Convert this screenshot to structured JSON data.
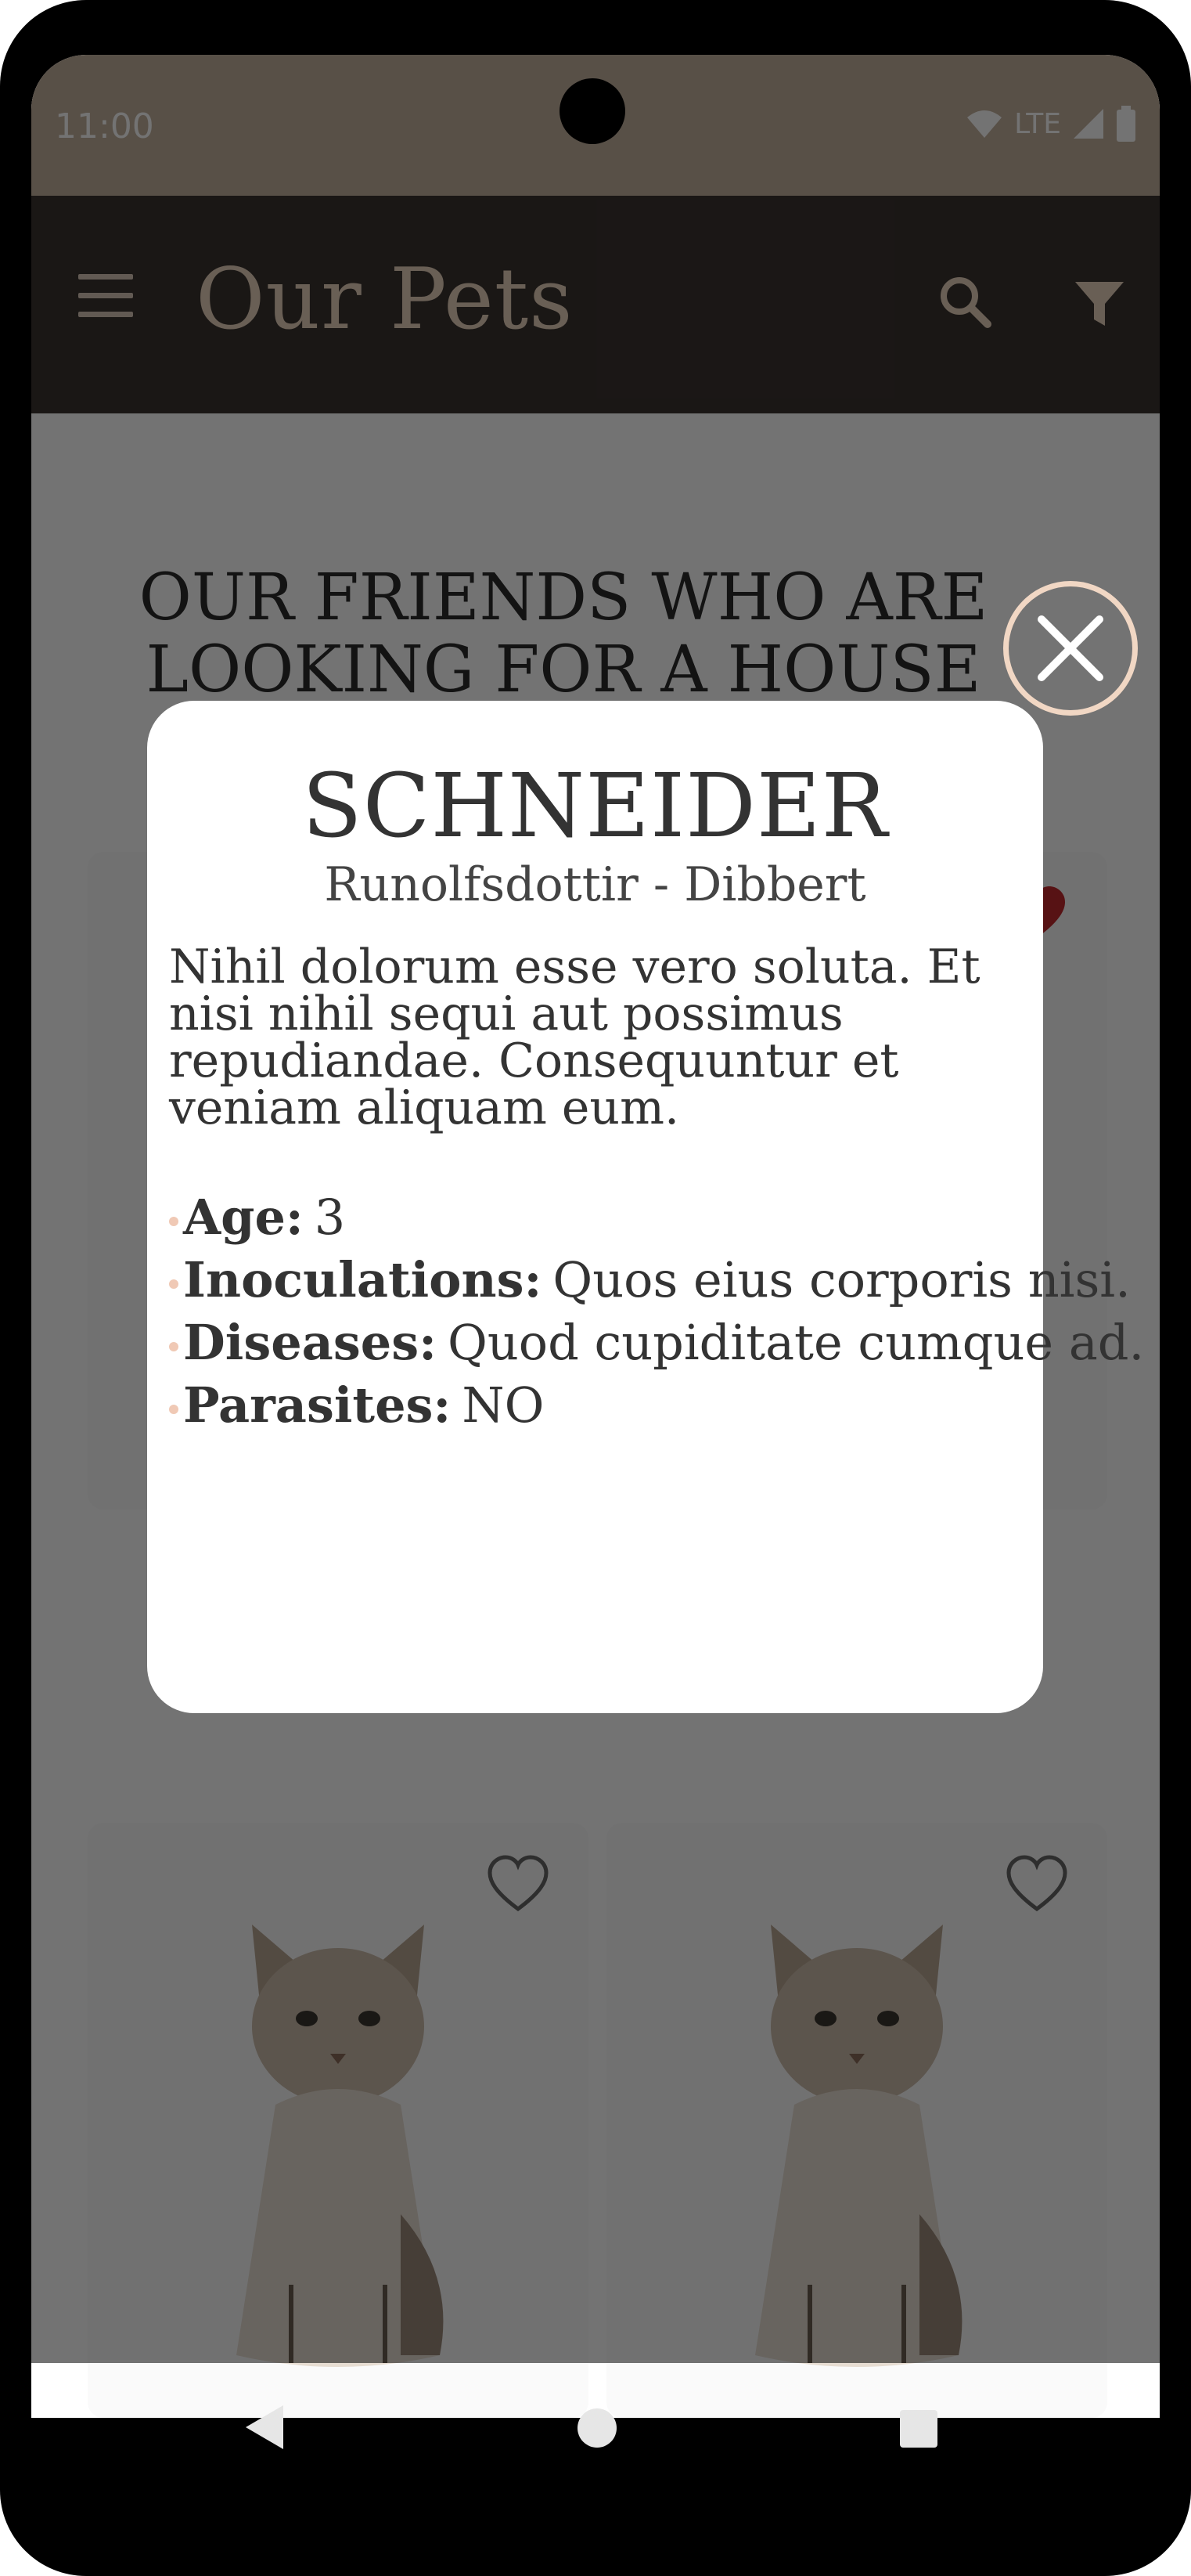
{
  "status_bar": {
    "time": "11:00",
    "network": "LTE"
  },
  "app_bar": {
    "title": "Our Pets"
  },
  "main": {
    "section_title": "OUR FRIENDS WHO ARE LOOKING FOR A HOUSE"
  },
  "modal": {
    "name": "SCHNEIDER",
    "organization": "Runolfsdottir - Dibbert",
    "description": "Nihil dolorum esse vero soluta. Et nisi nihil sequi aut possimus repudiandae. Consequuntur et veniam aliquam eum.",
    "facts": [
      {
        "label": "Age:",
        "value": "3"
      },
      {
        "label": "Inoculations:",
        "value": "Quos eius corporis nisi."
      },
      {
        "label": "Diseases:",
        "value": "Quod cupiditate cumque ad."
      },
      {
        "label": "Parasites:",
        "value": "NO"
      }
    ]
  },
  "icons": {
    "menu": "menu-icon",
    "search": "search-icon",
    "filter": "filter-icon",
    "favorite": "heart-icon",
    "close": "close-icon",
    "back": "back-icon",
    "home": "home-icon",
    "recents": "recents-icon"
  },
  "colors": {
    "app_bar": "#3b3330",
    "status_bar": "#c4b19e",
    "accent": "#f1d7c4",
    "title_text": "#e8d3bd",
    "heart_active": "#c0282d"
  }
}
